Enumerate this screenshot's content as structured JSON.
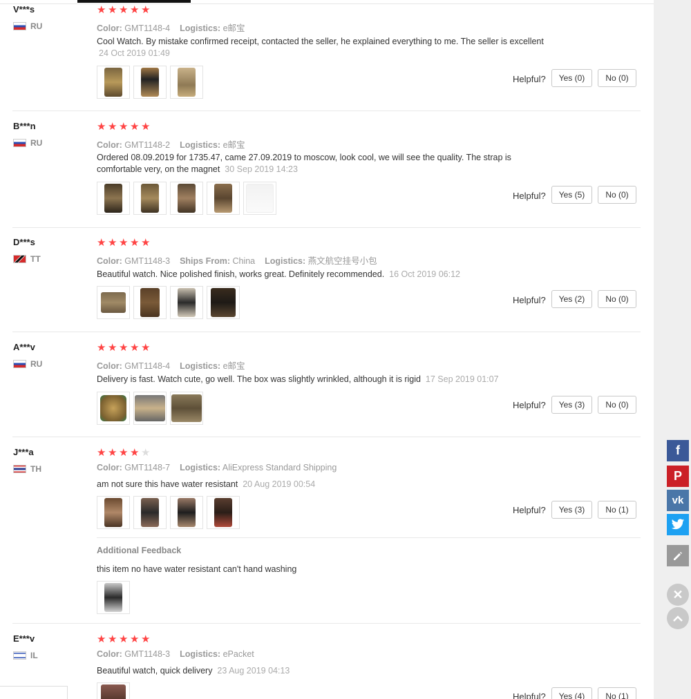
{
  "reviews": [
    {
      "user": "V***s",
      "country": "RU",
      "stars": 5,
      "color_label": "Color:",
      "color": "GMT1148-4",
      "logistics_label": "Logistics:",
      "logistics": "e邮宝",
      "text": "Cool Watch. By mistake confirmed receipt, contacted the seller, he explained everything to me. The seller is excellent",
      "date": "24 Oct 2019 01:49",
      "yes": "Yes (0)",
      "no": "No (0)"
    },
    {
      "user": "B***n",
      "country": "RU",
      "stars": 5,
      "color_label": "Color:",
      "color": "GMT1148-2",
      "logistics_label": "Logistics:",
      "logistics": "e邮宝",
      "text_line1": "Ordered 08.09.2019 for 1735.47, came 27.09.2019 to moscow, look cool, we will see the quality. The strap is",
      "text_line2": "comfortable very, on the magnet",
      "date": "30 Sep 2019 14:23",
      "yes": "Yes (5)",
      "no": "No (0)"
    },
    {
      "user": "D***s",
      "country": "TT",
      "stars": 5,
      "color_label": "Color:",
      "color": "GMT1148-3",
      "ships_label": "Ships From:",
      "ships": "China",
      "logistics_label": "Logistics:",
      "logistics": "燕文航空挂号小包",
      "text": "Beautiful watch. Nice polished finish, works great. Definitely recommended.",
      "date": "16 Oct 2019 06:12",
      "yes": "Yes (2)",
      "no": "No (0)"
    },
    {
      "user": "A***v",
      "country": "RU",
      "stars": 5,
      "color_label": "Color:",
      "color": "GMT1148-4",
      "logistics_label": "Logistics:",
      "logistics": "e邮宝",
      "text": "Delivery is fast. Watch cute, go well. The box was slightly wrinkled, although it is rigid",
      "date": "17 Sep 2019 01:07",
      "yes": "Yes (3)",
      "no": "No (0)"
    },
    {
      "user": "J***a",
      "country": "TH",
      "stars": 4,
      "color_label": "Color:",
      "color": "GMT1148-7",
      "logistics_label": "Logistics:",
      "logistics": "AliExpress Standard Shipping",
      "text": "am not sure this have water resistant",
      "date": "20 Aug 2019 00:54",
      "yes": "Yes (3)",
      "no": "No (1)",
      "additional_title": "Additional Feedback",
      "additional_text": "this item no have water resistant can't hand washing"
    },
    {
      "user": "E***v",
      "country": "IL",
      "stars": 5,
      "color_label": "Color:",
      "color": "GMT1148-3",
      "logistics_label": "Logistics:",
      "logistics": "ePacket",
      "text": "Beautiful watch, quick delivery",
      "date": "23 Aug 2019 04:13",
      "yes": "Yes (4)",
      "no": "No (1)"
    }
  ],
  "helpful_label": "Helpful?",
  "colors": {
    "star": "#ff4747",
    "facebook": "#3b5998",
    "pinterest": "#cb2027",
    "vk": "#4a76a8",
    "twitter": "#1da1f2",
    "edit": "#999999"
  },
  "share_icons": [
    "facebook-icon",
    "pinterest-icon",
    "vk-icon",
    "twitter-icon",
    "edit-icon"
  ],
  "share_glyphs": {
    "facebook": "f",
    "pinterest": "P",
    "vk": "vk"
  }
}
